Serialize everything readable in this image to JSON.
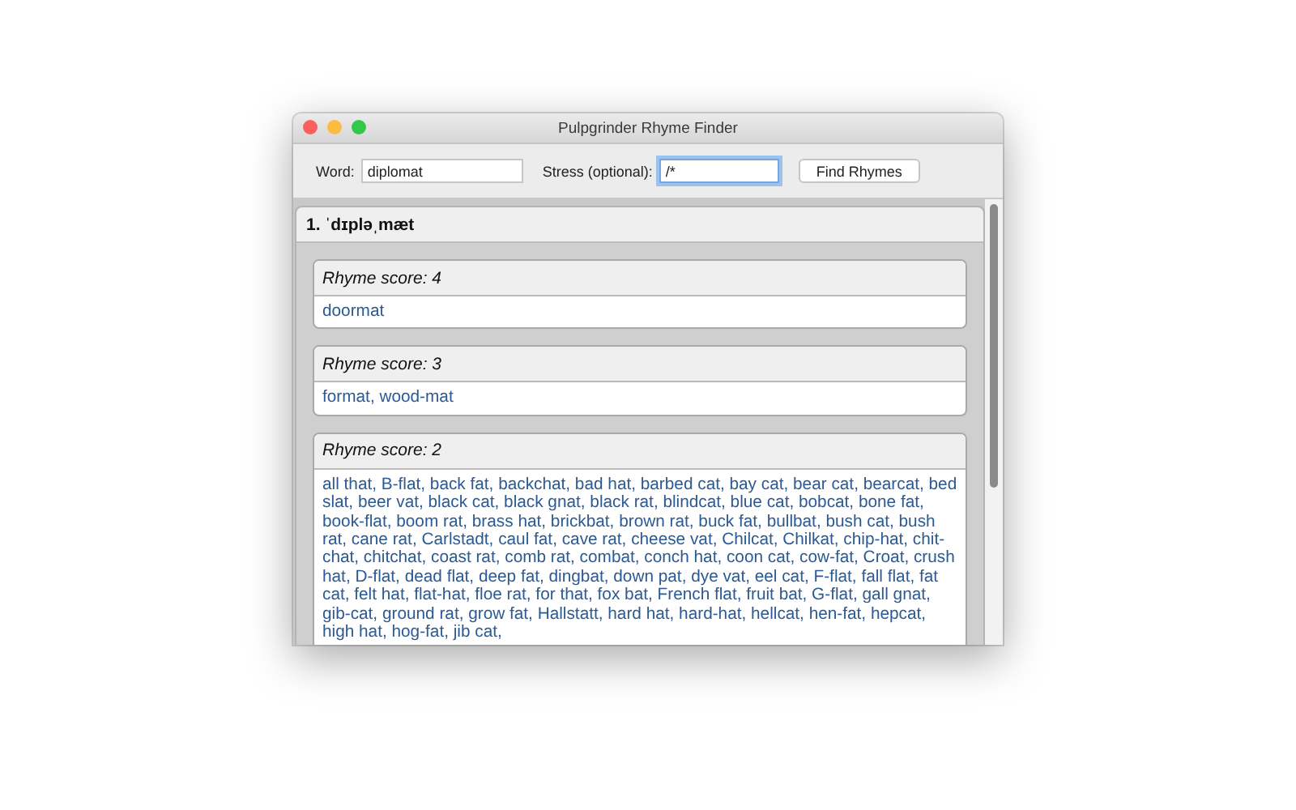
{
  "window": {
    "title": "Pulpgrinder Rhyme Finder"
  },
  "toolbar": {
    "word_label": "Word:",
    "word_value": "diplomat",
    "stress_label": "Stress (optional):",
    "stress_value": "/*",
    "stress_focused": true,
    "button": "Find Rhymes"
  },
  "results": [
    {
      "heading": "1. ˈdɪpləˌmæt",
      "groups": [
        {
          "title": "Rhyme score: 4",
          "words": "doormat"
        },
        {
          "title": "Rhyme score: 3",
          "words": "format, wood-mat"
        },
        {
          "title": "Rhyme score: 2",
          "words": "all that, B-flat, back fat, backchat, bad hat, barbed cat, bay cat, bear cat, bearcat, bed slat, beer vat, black cat, black gnat, black rat, blindcat, blue cat, bobcat, bone fat, book-flat, boom rat, brass hat, brickbat, brown rat, buck fat, bullbat, bush cat, bush rat, cane rat, Carlstadt, caul fat, cave rat, cheese vat, Chilcat, Chilkat, chip-hat, chit-chat, chitchat, coast rat, comb rat, combat, conch hat, coon cat, cow-fat, Croat, crush hat, D-flat, dead flat, deep fat, dingbat, down pat, dye vat, eel cat, F-flat, fall flat, fat cat, felt hat, flat-hat, floe rat, for that, fox bat, French flat, fruit bat, G-flat, gall gnat, gib-cat, ground rat, grow fat, Hallstatt, hard hat, hard-hat, hellcat, hen-fat, hepcat, high hat, hog-fat, jib cat,"
        }
      ]
    }
  ]
}
